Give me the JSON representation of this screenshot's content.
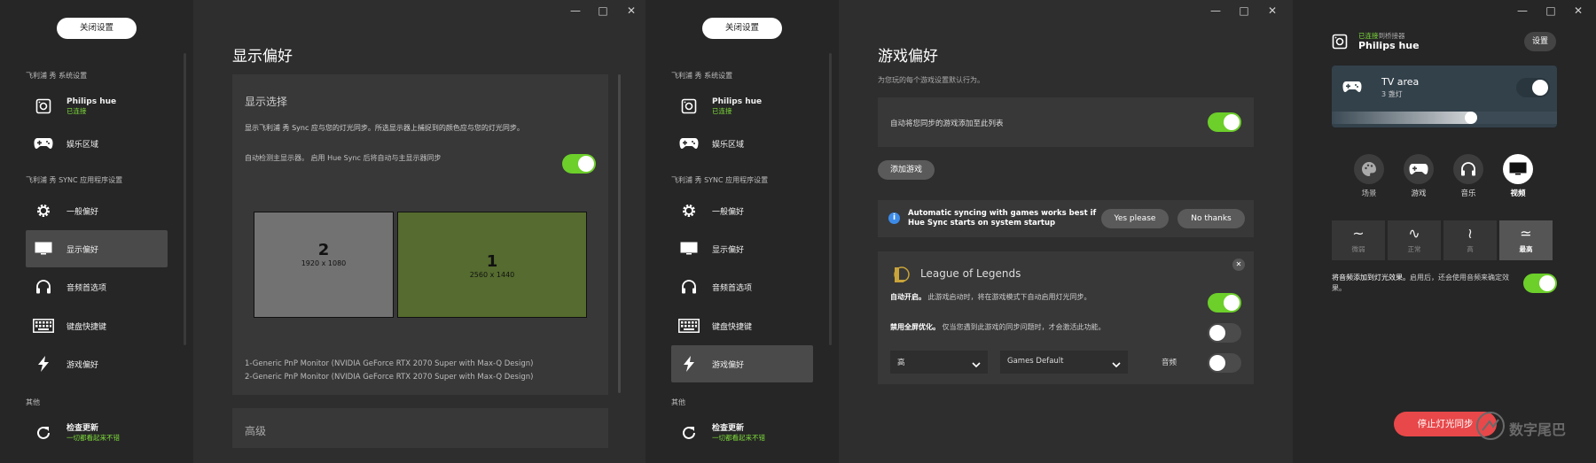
{
  "window1": {
    "close_settings": "关闭设置",
    "section_system": "飞利浦 秀 系统设置",
    "bridge_name": "Philips hue",
    "bridge_status": "已连接",
    "entertainment": "娱乐区域",
    "section_app": "飞利浦 秀 SYNC 应用程序设置",
    "nav": [
      "一般偏好",
      "显示偏好",
      "音频首选项",
      "键盘快捷键",
      "游戏偏好"
    ],
    "section_other": "其他",
    "update_label": "检查更新",
    "update_status": "一切都看起来不错",
    "page_title": "显示偏好",
    "display_select_heading": "显示选择",
    "display_desc": "显示飞利浦 秀 Sync 应与您的灯光同步。所选显示器上捕捉到的颜色应与您的灯光同步。",
    "autodetect_text": "自动检测主显示器。 启用 Hue Sync 后将自动与主显示器同步",
    "monitor2_num": "2",
    "monitor2_res": "1920 x 1080",
    "monitor1_num": "1",
    "monitor1_res": "2560 x 1440",
    "monitor_line1": "1-Generic PnP Monitor (NVIDIA GeForce RTX 2070 Super with Max-Q Design)",
    "monitor_line2": "2-Generic PnP Monitor (NVIDIA GeForce RTX 2070 Super with Max-Q Design)",
    "advanced": "高级"
  },
  "window2": {
    "page_title": "游戏偏好",
    "subtitle": "为您玩的每个游戏设置默认行为。",
    "auto_add_text": "自动将您同步的游戏添加至此列表",
    "add_game": "添加游戏",
    "info_text_1": "Automatic syncing with games works best if",
    "info_text_2": "Hue Sync starts on system startup",
    "yes_please": "Yes please",
    "no_thanks": "No thanks",
    "game_title": "League of Legends",
    "auto_start_label": "自动开启。",
    "auto_start_desc": "此游戏启动时，将在游戏模式下自动启用灯光同步。",
    "fullscreen_label": "禁用全屏优化。",
    "fullscreen_desc": "仅当您遇到此游戏的同步问题时，才会激活此功能。",
    "intensity_select": "高",
    "preset_select": "Games Default",
    "audio_label": "音频"
  },
  "window3": {
    "connected_prefix": "已连接",
    "connected_suffix": "到桥接器",
    "bridge_name": "Philips hue",
    "settings_button": "设置",
    "area_name": "TV area",
    "area_lights": "3 盏灯",
    "brightness": 0.62,
    "modes": [
      "场景",
      "游戏",
      "音乐",
      "视频"
    ],
    "intensity": [
      "微弱",
      "正常",
      "高",
      "最高"
    ],
    "audio_text_1": "将音频添加到灯光效果。",
    "audio_text_2": "启用后，还会使用音频来确定效",
    "audio_text_3": "果。",
    "stop_sync": "停止灯光同步",
    "watermark": "数字尾巴",
    "accent_green": "#6ccf2a",
    "stop_red": "#e8484a"
  }
}
